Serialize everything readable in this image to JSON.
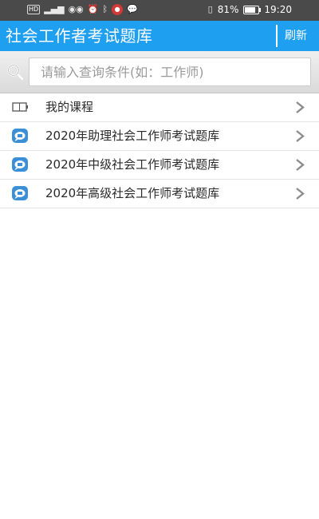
{
  "status_bar": {
    "carrier": "HD",
    "signal_label": "⁴ᴳ",
    "battery_percent": "81%",
    "battery_level": 0.81,
    "time": "19:20"
  },
  "header": {
    "title": "社会工作者考试题库",
    "refresh_label": "刷新"
  },
  "search": {
    "placeholder": "请输入查询条件(如：工作师)",
    "value": ""
  },
  "list": {
    "items": [
      {
        "label": "我的课程",
        "icon": "book-icon"
      },
      {
        "label": "2020年助理社会工作师考试题库",
        "icon": "chat-bubble-icon"
      },
      {
        "label": "2020年中级社会工作师考试题库",
        "icon": "chat-bubble-icon"
      },
      {
        "label": "2020年高级社会工作师考试题库",
        "icon": "chat-bubble-icon"
      }
    ]
  },
  "colors": {
    "header_bg": "#1f9ff0",
    "status_bg": "#4a4a4a",
    "icon_blue": "#3a8fd6",
    "chevron": "#8c8c8c"
  }
}
